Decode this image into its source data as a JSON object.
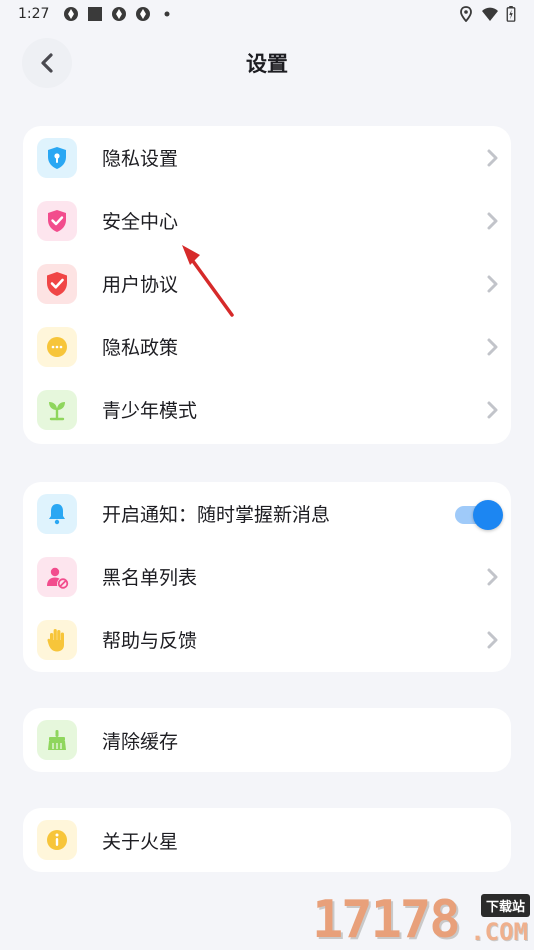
{
  "status_bar": {
    "time": "1:27",
    "left_icons": [
      "app-notification-icon",
      "stop-square-icon",
      "app-notification-icon",
      "app-notification-icon",
      "dot-icon"
    ],
    "right_icons": [
      "location-icon",
      "wifi-icon",
      "battery-charging-icon"
    ]
  },
  "header": {
    "title": "设置",
    "back_icon": "chevron-left-icon"
  },
  "groups": [
    {
      "items": [
        {
          "label": "隐私设置",
          "icon": "shield-lock-icon",
          "icon_bg": "#dff3fd",
          "icon_color": "#2aa7f3"
        },
        {
          "label": "安全中心",
          "icon": "shield-check-icon",
          "icon_bg": "#fde5ee",
          "icon_color": "#f24d8d"
        },
        {
          "label": "用户协议",
          "icon": "shield-check-icon",
          "icon_bg": "#fde3e3",
          "icon_color": "#f04545"
        },
        {
          "label": "隐私政策",
          "icon": "chat-bubble-icon",
          "icon_bg": "#fff6da",
          "icon_color": "#f7c53a"
        },
        {
          "label": "青少年模式",
          "icon": "sprout-icon",
          "icon_bg": "#e6f7dc",
          "icon_color": "#8fd65d"
        }
      ]
    },
    {
      "items": [
        {
          "label": "开启通知：随时掌握新消息",
          "icon": "bell-icon",
          "icon_bg": "#dff3fd",
          "icon_color": "#2aa7f3",
          "toggle_on": true
        },
        {
          "label": "黑名单列表",
          "icon": "user-block-icon",
          "icon_bg": "#fde5ee",
          "icon_color": "#f24d8d"
        },
        {
          "label": "帮助与反馈",
          "icon": "hand-icon",
          "icon_bg": "#fff6da",
          "icon_color": "#f7c53a"
        }
      ]
    },
    {
      "items": [
        {
          "label": "清除缓存",
          "icon": "broom-icon",
          "icon_bg": "#e6f7dc",
          "icon_color": "#8fd65d"
        }
      ]
    },
    {
      "items": [
        {
          "label": "关于火星",
          "icon": "info-icon",
          "icon_bg": "#fff6da",
          "icon_color": "#f7c53a"
        }
      ]
    }
  ],
  "colors": {
    "background": "#f4f5f9",
    "card": "#ffffff",
    "chevron": "#c2c4ca",
    "toggle_accent": "#1c86f2",
    "annotation_arrow": "#d62a2a"
  },
  "watermark": {
    "digits": "17178",
    "tag": "下载站",
    "suffix": ".COM"
  }
}
